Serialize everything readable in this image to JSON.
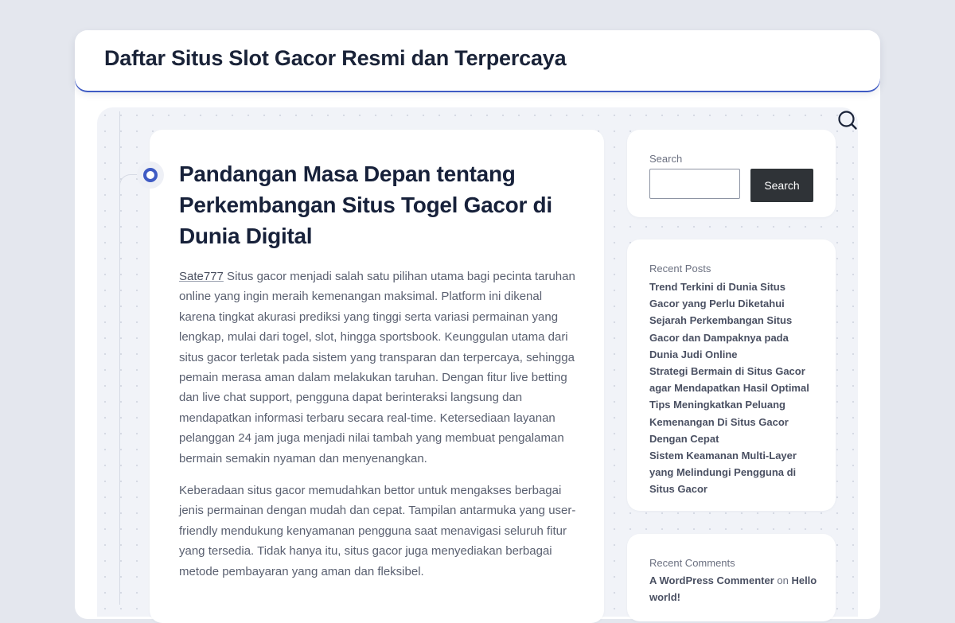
{
  "site": {
    "title": "Daftar Situs Slot Gacor Resmi dan Terpercaya"
  },
  "header": {
    "search_icon": "search-icon"
  },
  "post": {
    "title": "Pandangan Masa Depan tentang Perkembangan Situs Togel Gacor di Dunia Digital",
    "link_text": "Sate777",
    "paragraph1_rest": " Situs gacor menjadi salah satu pilihan utama bagi pecinta taruhan online yang ingin meraih kemenangan maksimal. Platform ini dikenal karena tingkat akurasi prediksi yang tinggi serta variasi permainan yang lengkap, mulai dari togel, slot, hingga sportsbook. Keunggulan utama dari situs gacor terletak pada sistem yang transparan dan terpercaya, sehingga pemain merasa aman dalam melakukan taruhan. Dengan fitur live betting dan live chat support, pengguna dapat berinteraksi langsung dan mendapatkan informasi terbaru secara real-time. Ketersediaan layanan pelanggan 24 jam juga menjadi nilai tambah yang membuat pengalaman bermain semakin nyaman dan menyenangkan.",
    "paragraph2": "Keberadaan situs gacor memudahkan bettor untuk mengakses berbagai jenis permainan dengan mudah dan cepat. Tampilan antarmuka yang user-friendly mendukung kenyamanan pengguna saat menavigasi seluruh fitur yang tersedia. Tidak hanya itu, situs gacor juga menyediakan berbagai metode pembayaran yang aman dan fleksibel."
  },
  "sidebar": {
    "search": {
      "label": "Search",
      "input_value": "",
      "button_label": "Search"
    },
    "recent_posts": {
      "heading": "Recent Posts",
      "items": [
        "Trend Terkini di Dunia Situs Gacor yang Perlu Diketahui",
        "Sejarah Perkembangan Situs Gacor dan Dampaknya pada Dunia Judi Online",
        "Strategi Bermain di Situs Gacor agar Mendapatkan Hasil Optimal",
        "Tips Meningkatkan Peluang Kemenangan Di Situs Gacor Dengan Cepat",
        "Sistem Keamanan Multi-Layer yang Melindungi Pengguna di Situs Gacor"
      ]
    },
    "recent_comments": {
      "heading": "Recent Comments",
      "author": "A WordPress Commenter",
      "on_text": " on ",
      "post": "Hello world!"
    }
  },
  "colors": {
    "accent": "#3f5bc4",
    "page_bg": "#e4e7ee",
    "button_bg": "#2f3337"
  }
}
